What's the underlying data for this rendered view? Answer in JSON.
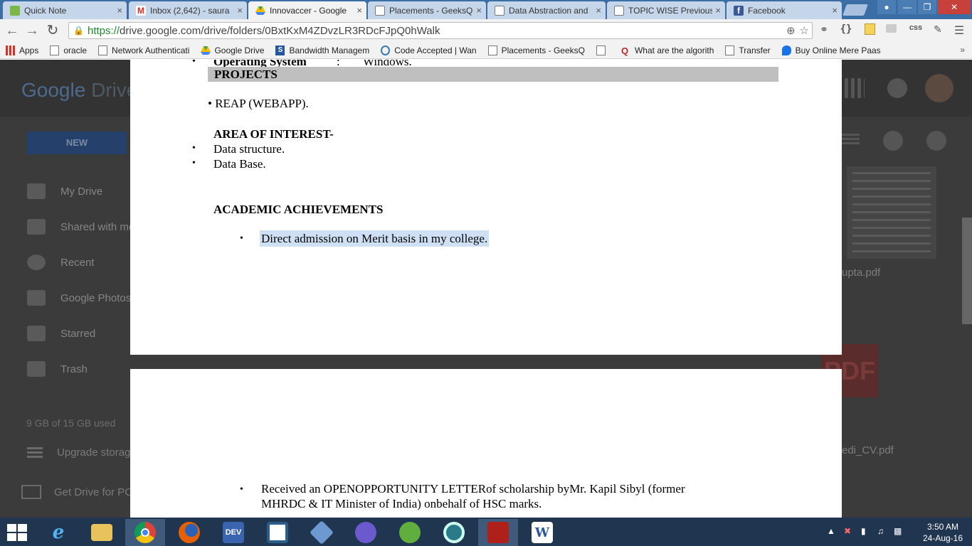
{
  "browser": {
    "tabs": [
      {
        "label": "Quick Note",
        "icon": "quicknote-icon"
      },
      {
        "label": "Inbox (2,642) - saura",
        "icon": "gmail-icon"
      },
      {
        "label": "Innovaccer - Google",
        "icon": "google-drive-icon"
      },
      {
        "label": "Placements - GeeksQ",
        "icon": "page-icon"
      },
      {
        "label": "Data Abstraction and",
        "icon": "page-icon"
      },
      {
        "label": "TOPIC WISE Previous",
        "icon": "page-icon"
      },
      {
        "label": "Facebook",
        "icon": "facebook-icon"
      }
    ],
    "close_glyph": "×",
    "url_secure": "https://",
    "url_rest": "drive.google.com/drive/folders/0BxtKxM4ZDvzLR3RDcFJpQ0hWalk",
    "ext_css": "css",
    "bookmarks": [
      {
        "label": "Apps"
      },
      {
        "label": "oracle"
      },
      {
        "label": "Network Authenticati"
      },
      {
        "label": "Google Drive"
      },
      {
        "label": "Bandwidth Managem"
      },
      {
        "label": "Code Accepted | Wan"
      },
      {
        "label": "Placements - GeeksQ"
      },
      {
        "label": ""
      },
      {
        "label": "What are the algorith"
      },
      {
        "label": "Transfer"
      },
      {
        "label": "Buy Online Mere Paas"
      }
    ],
    "bookmarks_more": "»"
  },
  "drive": {
    "logo_google": "Google",
    "logo_drive": " Drive",
    "new_button": "NEW",
    "nav": [
      {
        "label": "My Drive"
      },
      {
        "label": "Shared with me"
      },
      {
        "label": "Recent"
      },
      {
        "label": "Google Photos"
      },
      {
        "label": "Starred"
      },
      {
        "label": "Trash"
      }
    ],
    "storage": "9 GB of 15 GB used",
    "upgrade": "Upgrade storage",
    "get_drive": "Get Drive for PC",
    "file1": "upta.pdf",
    "file2": "edi_CV.pdf",
    "pdf_badge": "PDF"
  },
  "document": {
    "os_label": "Operating System",
    "os_sep": ":",
    "os_value": "Windows.",
    "projects_heading": "PROJECTS",
    "bullet": "•",
    "project_item": "REAP (WEBAPP).",
    "aoi_heading": "AREA OF INTEREST-",
    "aoi_items": [
      "Data structure.",
      "Data Base."
    ],
    "academic_heading": "ACADEMIC ACHIEVEMENTS",
    "academic_item": "Direct admission on Merit basis in my college.",
    "page2_line1": "Received an OPENOPPORTUNITY LETTERof scholarship byMr. Kapil Sibyl (former",
    "page2_line2": "MHRDC & IT Minister of India) onbehalf of HSC marks."
  },
  "taskbar": {
    "apps": [
      {
        "name": "internet-explorer",
        "label": "e",
        "color": "#1e90ff"
      },
      {
        "name": "file-explorer",
        "label": "",
        "color": "#e8c25a"
      },
      {
        "name": "chrome",
        "label": "",
        "color": "#dd4b39"
      },
      {
        "name": "firefox",
        "label": "",
        "color": "#e66000"
      },
      {
        "name": "dev-cpp",
        "label": "DEV",
        "color": "#3a63b0"
      },
      {
        "name": "bracket-app",
        "label": "",
        "color": "#2a5d8a"
      },
      {
        "name": "virtualbox",
        "label": "",
        "color": "#6c9ad0"
      },
      {
        "name": "cat-app",
        "label": "",
        "color": "#6a5acd"
      },
      {
        "name": "utorrent",
        "label": "",
        "color": "#5fae3e"
      },
      {
        "name": "chat-app",
        "label": "",
        "color": "#2a7a8a"
      },
      {
        "name": "adobe-reader",
        "label": "",
        "color": "#b0201a"
      },
      {
        "name": "word",
        "label": "W",
        "color": "#2b579a"
      }
    ],
    "time": "3:50 AM",
    "date": "24-Aug-16"
  }
}
